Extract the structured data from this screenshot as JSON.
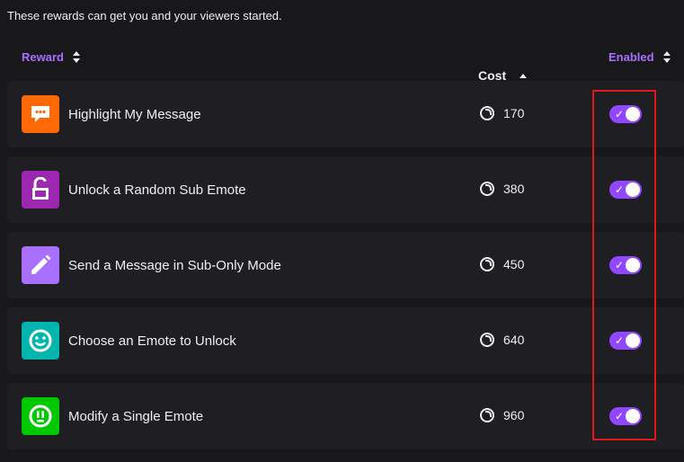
{
  "intro_text": "These rewards can get you and your viewers started.",
  "columns": {
    "reward": "Reward",
    "cost": "Cost",
    "enabled": "Enabled"
  },
  "colors": {
    "accent": "#a970ff",
    "toggle_on": "#9147ff",
    "highlight_box": "#e0181b"
  },
  "rewards": [
    {
      "title": "Highlight My Message",
      "cost": "170",
      "enabled": true,
      "icon": "chat-bubble-icon",
      "icon_color": "#ff6905"
    },
    {
      "title": "Unlock a Random Sub Emote",
      "cost": "380",
      "enabled": true,
      "icon": "unlock-icon",
      "icon_color": "#9c27b0"
    },
    {
      "title": "Send a Message in Sub-Only Mode",
      "cost": "450",
      "enabled": true,
      "icon": "pencil-icon",
      "icon_color": "#a970ff"
    },
    {
      "title": "Choose an Emote to Unlock",
      "cost": "640",
      "enabled": true,
      "icon": "smiley-icon",
      "icon_color": "#00b5ad"
    },
    {
      "title": "Modify a Single Emote",
      "cost": "960",
      "enabled": true,
      "icon": "emote-modify-icon",
      "icon_color": "#00c800"
    }
  ]
}
